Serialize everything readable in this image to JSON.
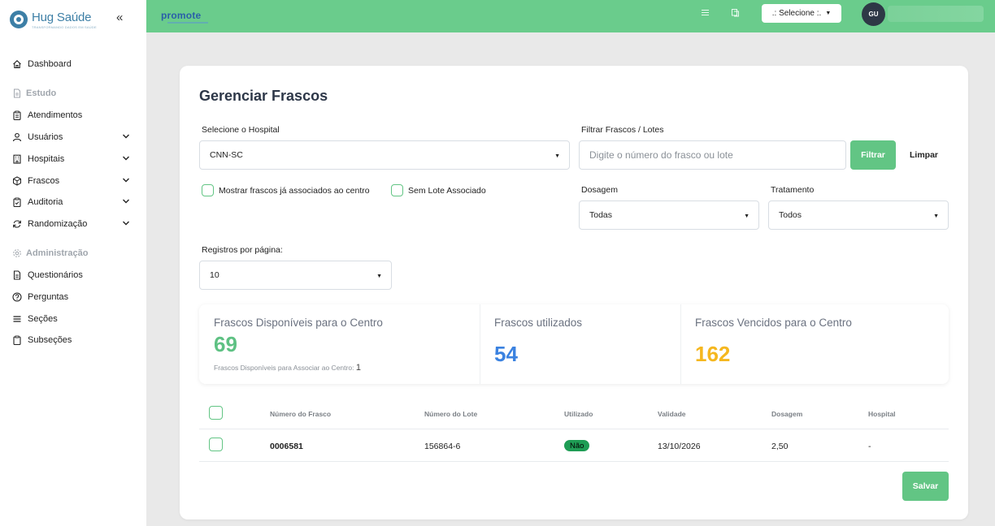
{
  "brand": {
    "name": "Hug Saúde",
    "tagline": "TRANSFORMANDO DADOS EM SAÚDE"
  },
  "sidebar": {
    "collapse_icon": "«",
    "items": [
      {
        "label": "Dashboard",
        "icon": "home-icon",
        "type": "item"
      },
      {
        "label": "Estudo",
        "icon": "document-icon",
        "type": "section"
      },
      {
        "label": "Atendimentos",
        "icon": "clipboard-icon",
        "type": "item"
      },
      {
        "label": "Usuários",
        "icon": "users-icon",
        "type": "item",
        "expandable": true
      },
      {
        "label": "Hospitais",
        "icon": "building-icon",
        "type": "item",
        "expandable": true
      },
      {
        "label": "Frascos",
        "icon": "cube-icon",
        "type": "item",
        "expandable": true
      },
      {
        "label": "Auditoria",
        "icon": "clipboard-check-icon",
        "type": "item",
        "expandable": true
      },
      {
        "label": "Randomização",
        "icon": "refresh-icon",
        "type": "item",
        "expandable": true
      },
      {
        "label": "Administração",
        "icon": "gear-icon",
        "type": "section"
      },
      {
        "label": "Questionários",
        "icon": "file-icon",
        "type": "item"
      },
      {
        "label": "Perguntas",
        "icon": "question-icon",
        "type": "item"
      },
      {
        "label": "Seções",
        "icon": "menu-icon",
        "type": "item"
      },
      {
        "label": "Subseções",
        "icon": "clipboard-icon",
        "type": "item"
      }
    ]
  },
  "topbar": {
    "logo": "promote",
    "select_label": ".: Selecione :.",
    "avatar_initials": "GU",
    "accent": "#6acc8c"
  },
  "page": {
    "title": "Gerenciar Frascos",
    "hospital_label": "Selecione o Hospital",
    "hospital_value": "CNN-SC",
    "filter_label": "Filtrar Frascos / Lotes",
    "filter_placeholder": "Digite o número do frasco ou lote",
    "filter_button": "Filtrar",
    "clear_button": "Limpar",
    "checkbox_associated": "Mostrar frascos já associados ao centro",
    "checkbox_no_lot": "Sem Lote Associado",
    "dosage_label": "Dosagem",
    "dosage_value": "Todas",
    "treatment_label": "Tratamento",
    "treatment_value": "Todos",
    "per_page_label": "Registros por página:",
    "per_page_value": "10",
    "save_button": "Salvar"
  },
  "stats": {
    "available_title": "Frascos Disponíveis para o Centro",
    "available_value": "69",
    "available_foot": "Frascos Disponíveis para Associar ao Centro:",
    "available_foot_value": "1",
    "used_title": "Frascos utilizados",
    "used_value": "54",
    "expired_title": "Frascos Vencidos para o Centro",
    "expired_value": "162",
    "colors": {
      "available": "#5ec183",
      "used": "#3b82e0",
      "expired": "#f5b71f"
    }
  },
  "table": {
    "headers": [
      "Número do Frasco",
      "Número do Lote",
      "Utilizado",
      "Validade",
      "Dosagem",
      "Hospital"
    ],
    "rows": [
      {
        "frasco": "0006581",
        "lote": "156864-6",
        "utilizado": "Não",
        "validade": "13/10/2026",
        "dosagem": "2,50",
        "hospital": "-"
      }
    ]
  }
}
